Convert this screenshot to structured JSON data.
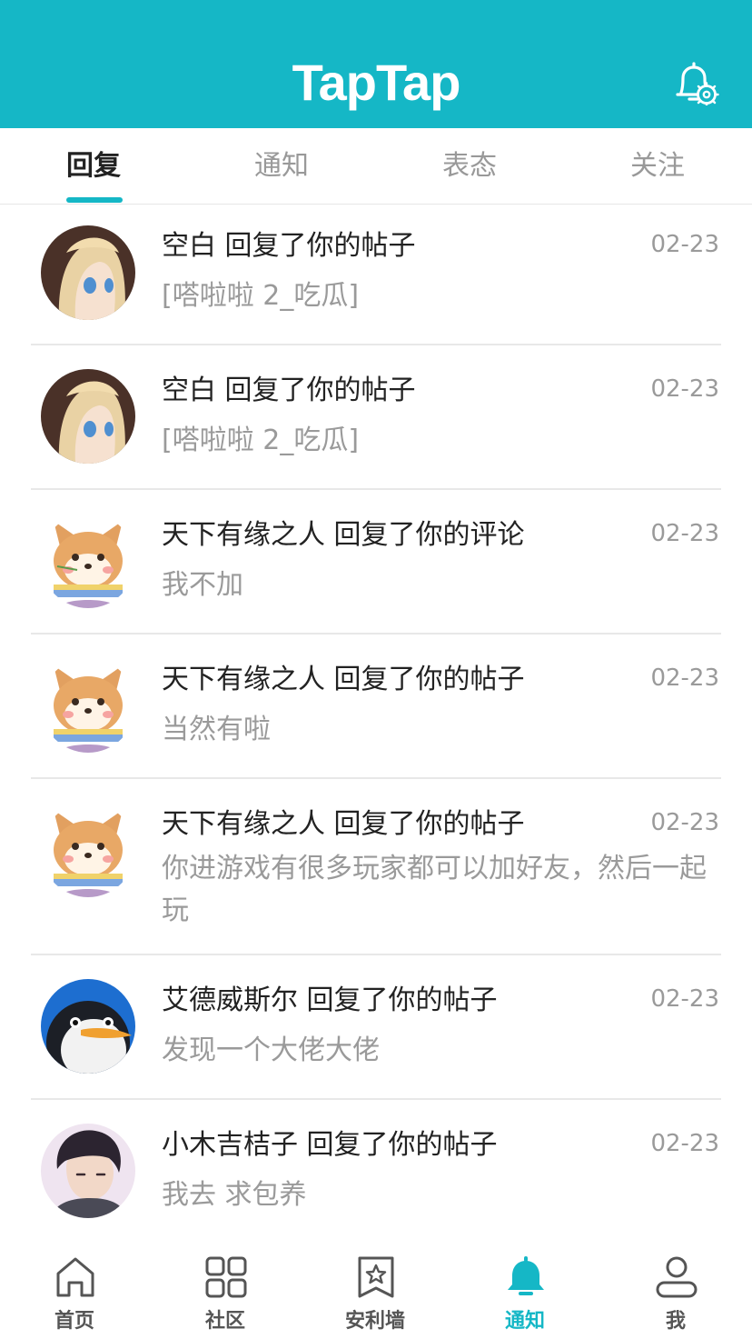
{
  "header": {
    "logo_text": "TapTap",
    "settings_icon": "bell-gear-icon"
  },
  "tabs": [
    {
      "label": "回复",
      "active": true
    },
    {
      "label": "通知",
      "active": false
    },
    {
      "label": "表态",
      "active": false
    },
    {
      "label": "关注",
      "active": false
    }
  ],
  "notifications": [
    {
      "avatar": "anime-girl-avatar",
      "user": "空白",
      "action": "回复了你的帖子",
      "date": "02-23",
      "preview": "[嗒啦啦 2_吃瓜]"
    },
    {
      "avatar": "anime-girl-avatar",
      "user": "空白",
      "action": "回复了你的帖子",
      "date": "02-23",
      "preview": "[嗒啦啦 2_吃瓜]"
    },
    {
      "avatar": "shiba-dog-avatar",
      "user": "天下有缘之人",
      "action": "回复了你的评论",
      "date": "02-23",
      "preview": "我不加"
    },
    {
      "avatar": "shiba-dog-avatar",
      "user": "天下有缘之人",
      "action": "回复了你的帖子",
      "date": "02-23",
      "preview": "当然有啦"
    },
    {
      "avatar": "shiba-dog-avatar",
      "user": "天下有缘之人",
      "action": "回复了你的帖子",
      "date": "02-23",
      "preview": "你进游戏有很多玩家都可以加好友，然后一起玩"
    },
    {
      "avatar": "penguin-avatar",
      "user": "艾德威斯尔",
      "action": "回复了你的帖子",
      "date": "02-23",
      "preview": "发现一个大佬大佬"
    },
    {
      "avatar": "anime-boy-avatar",
      "user": "小木吉桔子",
      "action": "回复了你的帖子",
      "date": "02-23",
      "preview": "我去 求包养"
    }
  ],
  "bottom_nav": [
    {
      "label": "首页",
      "icon": "home-icon",
      "active": false
    },
    {
      "label": "社区",
      "icon": "grid-icon",
      "active": false
    },
    {
      "label": "安利墙",
      "icon": "star-bookmark-icon",
      "active": false
    },
    {
      "label": "通知",
      "icon": "bell-icon",
      "active": true
    },
    {
      "label": "我",
      "icon": "user-icon",
      "active": false
    }
  ],
  "colors": {
    "accent": "#15b7c6",
    "text_primary": "#222222",
    "text_secondary": "#9a9a9a",
    "nav_inactive": "#555555"
  }
}
